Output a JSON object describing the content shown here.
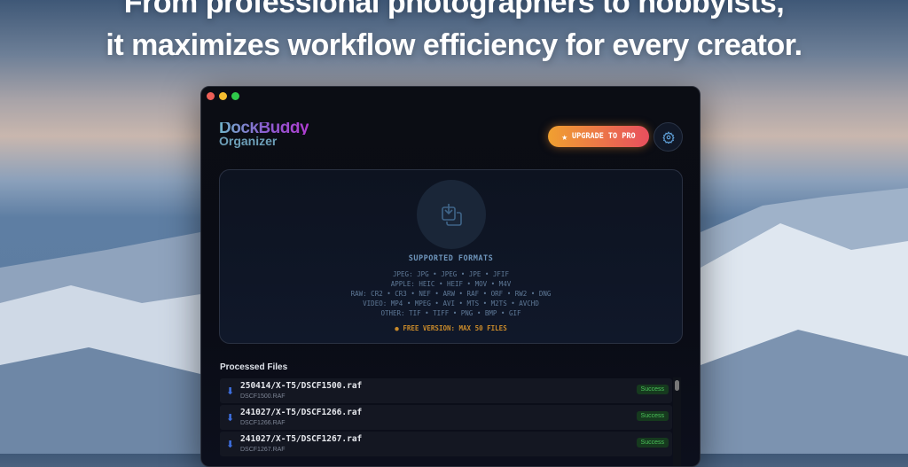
{
  "headline": {
    "line1": "From professional photographers to hobbyists,",
    "line2": "it maximizes workflow efficiency for every creator."
  },
  "app": {
    "logo_line1": "DockBuddy",
    "logo_line2": "Organizer",
    "upgrade_label": "UPGRADE TO PRO"
  },
  "dropzone": {
    "title": "SUPPORTED FORMATS",
    "formats": [
      "JPEG: JPG • JPEG • JPE • JFIF",
      "APPLE: HEIC • HEIF • MOV • M4V",
      "RAW: CR2 • CR3 • NEF • ARW • RAF • ORF • RW2 • DNG",
      "VIDEO: MP4 • MPEG • AVI • MTS • M2TS • AVCHD",
      "OTHER: TIF • TIFF • PNG • BMP • GIF"
    ],
    "free_notice": "FREE VERSION: MAX 50 FILES"
  },
  "processed": {
    "title": "Processed Files",
    "files": [
      {
        "path": "250414/X-T5/DSCF1500.raf",
        "name": "DSCF1500.RAF",
        "status": "Success"
      },
      {
        "path": "241027/X-T5/DSCF1266.raf",
        "name": "DSCF1266.RAF",
        "status": "Success"
      },
      {
        "path": "241027/X-T5/DSCF1267.raf",
        "name": "DSCF1267.RAF",
        "status": "Success"
      }
    ]
  }
}
